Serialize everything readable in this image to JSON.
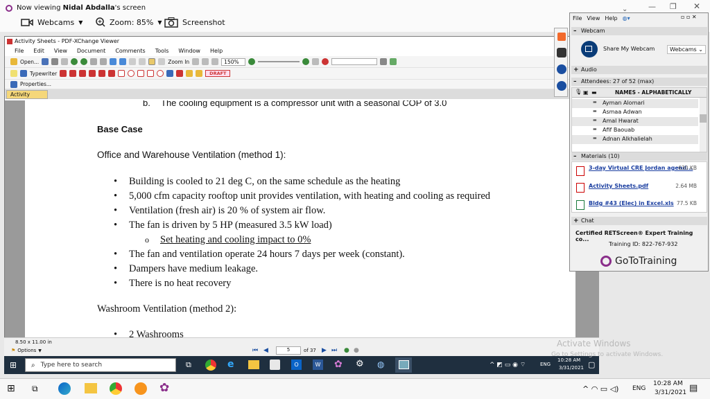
{
  "viewer": {
    "viewing_prefix": "Now viewing ",
    "viewing_name": "Nidal Abdalla",
    "viewing_suffix": "'s screen",
    "webcams_label": "Webcams",
    "zoom_label": "Zoom: 85%",
    "screenshot_label": "Screenshot"
  },
  "pdf": {
    "title": "Activity Sheets - PDF-XChange Viewer",
    "menu": [
      "File",
      "Edit",
      "View",
      "Document",
      "Comments",
      "Tools",
      "Window",
      "Help"
    ],
    "open_label": "Open...",
    "zoom_in_label": "Zoom In",
    "zoom_value": "150%",
    "typewriter_label": "Typewriter",
    "draft_label": "DRAFT",
    "properties_label": "Properties...",
    "tab_label": "Activity Sheets",
    "page_size": "8.50 x 11.00 in",
    "options_label": "Options",
    "page_current": "5",
    "page_total": "of 37"
  },
  "doc": {
    "cut_line_label": "b.",
    "cut_line": "The cooling equipment is a compressor unit with a seasonal COP of 3.0",
    "heading": "Base Case",
    "section1": "Office and Warehouse Ventilation (method 1):",
    "bullets": [
      "Building is cooled to 21 deg C, on the same schedule as the heating",
      "5,000 cfm capacity rooftop unit provides ventilation, with heating and cooling as required",
      "Ventilation (fresh air) is 20 % of system air flow.",
      "The fan is driven by 5 HP (measured 3.5 kW load)"
    ],
    "sub_bullet": "Set heating and cooling impact to 0%",
    "bullets2": [
      "The fan and ventilation operate 24 hours 7 days per week (constant).",
      "Dampers have medium leakage.",
      "There is no heat recovery"
    ],
    "section2": "Washroom Ventilation (method 2):",
    "bullet3": "2 Washrooms"
  },
  "panel": {
    "menu": [
      "File",
      "View",
      "Help"
    ],
    "webcam_header": "Webcam",
    "share_webcam": "Share My Webcam",
    "webcams_dropdown": "Webcams",
    "audio_header": "Audio",
    "attendees_header": "Attendees:  27 of 52 (max)",
    "names_header": "NAMES - ALPHABETICALLY",
    "attendees": [
      "Ayman  Alomari",
      "Asmaa  Adwan",
      "Amal  Hwarat",
      "Afif Baouab",
      "Adnan Alkhalielah"
    ],
    "materials_header": "Materials (10)",
    "materials": [
      {
        "name": "3-day Virtual CRE Jordan agend...",
        "size": "630 KB"
      },
      {
        "name": "Activity Sheets.pdf",
        "size": "2.64 MB"
      },
      {
        "name": "Bldg #43 (Elec) in Excel.xls",
        "size": "77.5 KB"
      }
    ],
    "chat_header": "Chat",
    "session_title": "Certified RETScreen® Expert Training co...",
    "training_id": "Training ID: 822-767-932",
    "brand": "GoToTraining"
  },
  "remote_taskbar": {
    "search_placeholder": "Type here to search",
    "lang": "ENG",
    "time": "10:28 AM",
    "date": "3/31/2021"
  },
  "host_taskbar": {
    "lang": "ENG",
    "time": "10:28 AM",
    "date": "3/31/2021"
  },
  "watermark": {
    "title": "Activate Windows",
    "subtitle": "Go to Settings to activate Windows."
  },
  "colors": {
    "brand_purple": "#8a2e8a",
    "win_blue": "#0a3c78",
    "link_blue": "#1a3ea0"
  }
}
